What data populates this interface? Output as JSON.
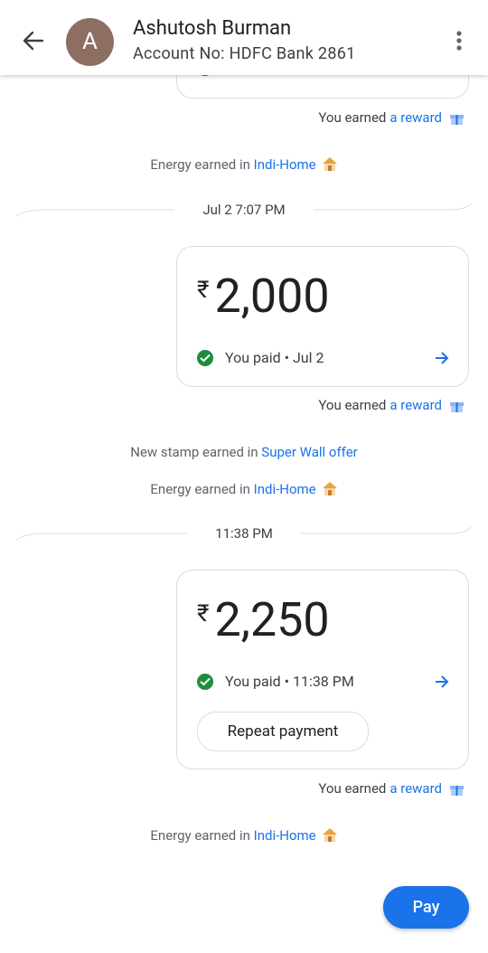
{
  "header": {
    "avatar_letter": "A",
    "contact_name": "Ashutosh Burman",
    "account_line": "Account No: HDFC Bank 2861"
  },
  "transactions": [
    {
      "reward_prefix": "You earned",
      "reward_link": "a reward",
      "energy_prefix": "Energy earned in",
      "energy_link": "Indi-Home"
    },
    {
      "date_label": "Jul 2 7:07 PM",
      "currency": "₹",
      "amount": "2,000",
      "status": "You paid • Jul 2",
      "reward_prefix": "You earned",
      "reward_link": "a reward",
      "stamp_prefix": "New stamp earned in",
      "stamp_link": "Super Wall offer",
      "energy_prefix": "Energy earned in",
      "energy_link": "Indi-Home"
    },
    {
      "date_label": "11:38 PM",
      "currency": "₹",
      "amount": "2,250",
      "status": "You paid • 11:38 PM",
      "repeat_label": "Repeat payment",
      "reward_prefix": "You earned",
      "reward_link": "a reward",
      "energy_prefix": "Energy earned in",
      "energy_link": "Indi-Home"
    }
  ],
  "pay_button": "Pay",
  "colors": {
    "accent": "#1a73e8",
    "success": "#1e8e3e",
    "avatar": "#8d6e63"
  },
  "icons": [
    "back-arrow-icon",
    "more-vert-icon",
    "check-circle-icon",
    "arrow-right-icon",
    "gift-icon",
    "house-icon"
  ]
}
